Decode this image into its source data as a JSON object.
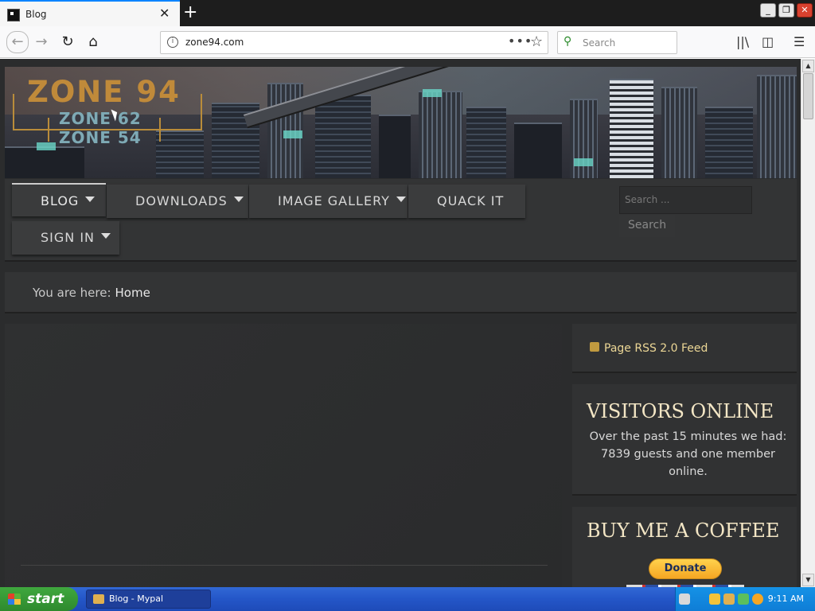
{
  "browser": {
    "tab_title": "Blog",
    "tab_close": "✕",
    "new_tab": "+",
    "url": "zone94.com",
    "url_more": "•••",
    "search_placeholder": "Search",
    "win_min": "_",
    "win_restore": "❐",
    "win_close": "✕"
  },
  "site": {
    "logo_main": "ZONE 94",
    "logo_sub1": "ZONE 62",
    "logo_sub2": "ZONE 54",
    "menu": [
      {
        "label": "BLOG",
        "has_caret": true,
        "active": true
      },
      {
        "label": "DOWNLOADS",
        "has_caret": true
      },
      {
        "label": "IMAGE GALLERY",
        "has_caret": true
      },
      {
        "label": "QUACK IT",
        "has_caret": false
      },
      {
        "label": "SIGN IN",
        "has_caret": true
      }
    ],
    "search_placeholder": "Search ...",
    "search_button": "Search",
    "breadcrumb_prefix": "You are here:",
    "breadcrumb_current": "Home",
    "rss_link": "Page RSS 2.0 Feed",
    "visitors_title": "VISITORS ONLINE",
    "visitors_text": "Over the past 15 minutes we had: 7839 guests and one member online.",
    "coffee_title": "BUY ME A COFFEE",
    "donate_label": "Donate"
  },
  "taskbar": {
    "start_label": "start",
    "task_label": "Blog - Mypal",
    "clock": "9:11 AM"
  },
  "colors": {
    "page_bg": "#2b2c2d",
    "panel_bg": "#333435",
    "accent_gold": "#ecd796",
    "heading": "#f3e6c5",
    "taskbar_blue": "#2456c8",
    "start_green": "#3fa83e"
  }
}
